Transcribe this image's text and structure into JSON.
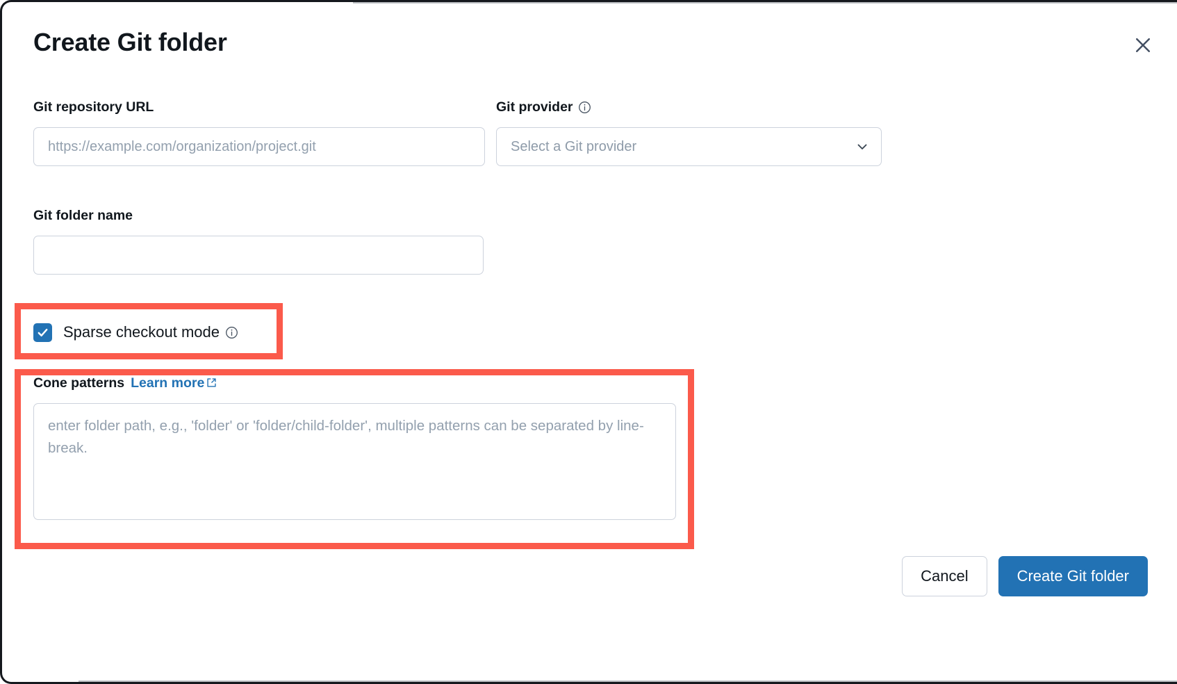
{
  "dialog": {
    "title": "Create Git folder",
    "close_icon": "close-icon"
  },
  "fields": {
    "repo_url": {
      "label": "Git repository URL",
      "placeholder": "https://example.com/organization/project.git",
      "value": ""
    },
    "provider": {
      "label": "Git provider",
      "info_icon": "info-icon",
      "selected": "Select a Git provider",
      "chevron_icon": "chevron-down-icon"
    },
    "folder_name": {
      "label": "Git folder name",
      "placeholder": "",
      "value": ""
    }
  },
  "sparse_checkout": {
    "label": "Sparse checkout mode",
    "checked": true,
    "info_icon": "info-icon"
  },
  "cone_patterns": {
    "label": "Cone patterns",
    "learn_more": "Learn more",
    "external_icon": "external-link-icon",
    "placeholder": "enter folder path, e.g., 'folder' or 'folder/child-folder', multiple patterns can be separated by line-break.",
    "value": ""
  },
  "footer": {
    "cancel_label": "Cancel",
    "create_label": "Create Git folder"
  },
  "colors": {
    "accent_blue": "#2272b4",
    "annotation_red": "#fb5a4b",
    "border_gray": "#ccd2dc",
    "placeholder_gray": "#93a0ae",
    "text_dark": "#11171d"
  }
}
